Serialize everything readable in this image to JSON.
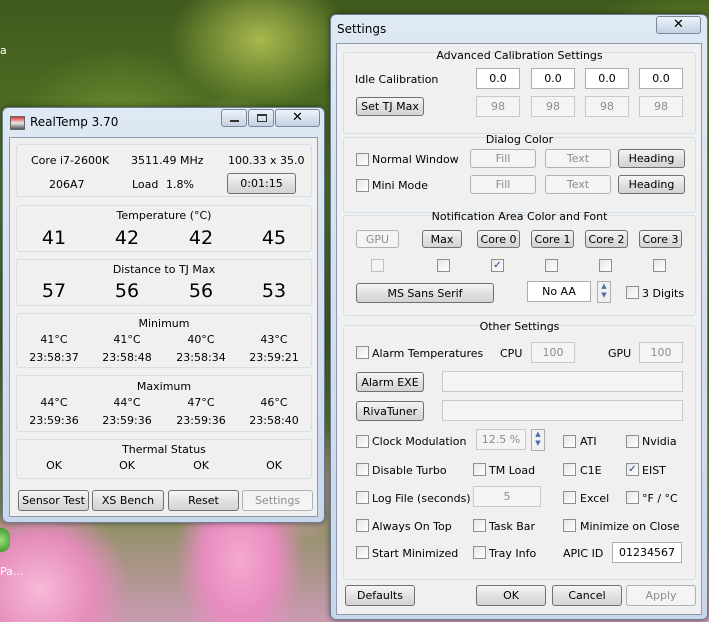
{
  "desktop": {
    "left_icon_text": "a",
    "bottom_icon_text": "Pa..."
  },
  "realtemp": {
    "title": "RealTemp 3.70",
    "cpu": "Core i7-2600K",
    "mhz": "3511.49 MHz",
    "mult": "100.33 x 35.0",
    "stepping": "206A7",
    "load_label": "Load",
    "load": "1.8%",
    "timer": "0:01:15",
    "temp_header": "Temperature (°C)",
    "temps": [
      "41",
      "42",
      "42",
      "45"
    ],
    "dist_header": "Distance to TJ Max",
    "dists": [
      "57",
      "56",
      "56",
      "53"
    ],
    "min_header": "Minimum",
    "min_vals": [
      "41°C",
      "41°C",
      "40°C",
      "43°C"
    ],
    "min_times": [
      "23:58:37",
      "23:58:48",
      "23:58:34",
      "23:59:21"
    ],
    "max_header": "Maximum",
    "max_vals": [
      "44°C",
      "44°C",
      "47°C",
      "46°C"
    ],
    "max_times": [
      "23:59:36",
      "23:59:36",
      "23:59:36",
      "23:58:40"
    ],
    "thermal_header": "Thermal Status",
    "thermal": [
      "OK",
      "OK",
      "OK",
      "OK"
    ],
    "buttons": {
      "sensor": "Sensor Test",
      "xs": "XS Bench",
      "reset": "Reset",
      "settings": "Settings"
    }
  },
  "settings": {
    "title": "Settings",
    "calib": {
      "header": "Advanced Calibration Settings",
      "idle_label": "Idle Calibration",
      "idle": [
        "0.0",
        "0.0",
        "0.0",
        "0.0"
      ],
      "set_tj": "Set TJ Max",
      "tj": [
        "98",
        "98",
        "98",
        "98"
      ]
    },
    "dialog": {
      "header": "Dialog Color",
      "normal": "Normal Window",
      "mini": "Mini Mode",
      "fill": "Fill",
      "text": "Text",
      "heading": "Heading"
    },
    "notif": {
      "header": "Notification Area Color and Font",
      "caps": [
        "GPU",
        "Max",
        "Core 0",
        "Core 1",
        "Core 2",
        "Core 3"
      ],
      "checks": [
        false,
        false,
        true,
        false,
        false,
        false
      ],
      "font": "MS Sans Serif",
      "aa": "No AA",
      "digits": "3 Digits"
    },
    "other": {
      "header": "Other Settings",
      "alarm_temps": "Alarm Temperatures",
      "cpu_label": "CPU",
      "cpu_val": "100",
      "gpu_label": "GPU",
      "gpu_val": "100",
      "alarm_exe": "Alarm EXE",
      "rivatuner": "RivaTuner",
      "clock_mod": "Clock Modulation",
      "clock_val": "12.5 %",
      "ati": "ATI",
      "nvidia": "Nvidia",
      "disable_turbo": "Disable Turbo",
      "tm_load": "TM Load",
      "c1e": "C1E",
      "eist": "EIST",
      "log_file": "Log File (seconds)",
      "log_val": "5",
      "excel": "Excel",
      "fc": "°F / °C",
      "always_top": "Always On Top",
      "task_bar": "Task Bar",
      "min_close": "Minimize on Close",
      "start_min": "Start Minimized",
      "tray_info": "Tray Info",
      "apic_label": "APIC ID",
      "apic": "01234567"
    },
    "buttons": {
      "defaults": "Defaults",
      "ok": "OK",
      "cancel": "Cancel",
      "apply": "Apply"
    }
  }
}
